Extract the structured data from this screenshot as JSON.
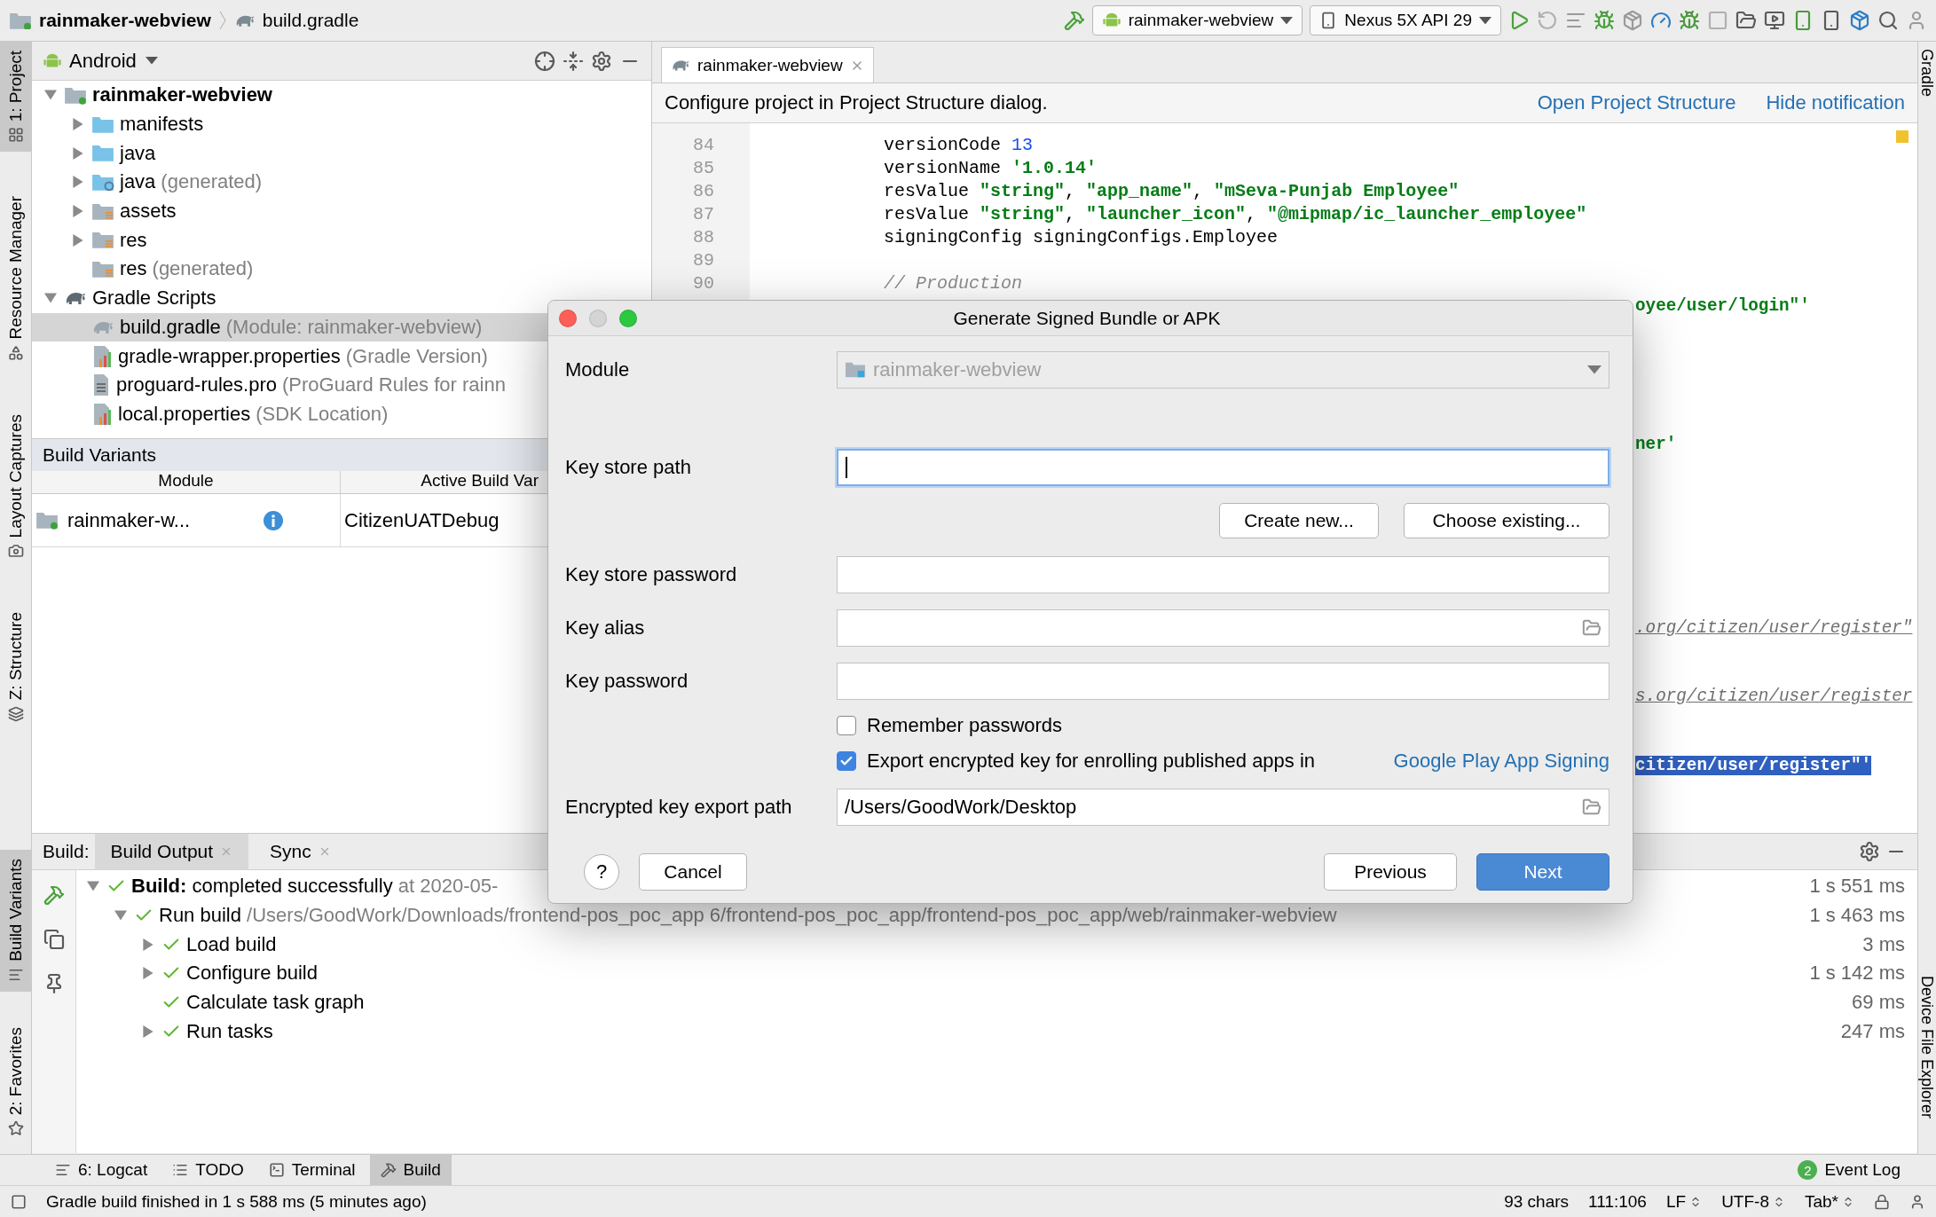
{
  "nav_bar": {
    "breadcrumbs": [
      "rainmaker-webview",
      "build.gradle"
    ],
    "run_config": "rainmaker-webview",
    "device": "Nexus 5X API 29"
  },
  "left_stripe": {
    "top": [
      {
        "label": "1: Project",
        "selected": true
      },
      {
        "label": "Resource Manager",
        "selected": false
      },
      {
        "label": "Layout Captures",
        "selected": false
      },
      {
        "label": "Z: Structure",
        "selected": false
      }
    ],
    "bottom": [
      {
        "label": "Build Variants",
        "selected": true
      },
      {
        "label": "2: Favorites",
        "selected": false
      }
    ]
  },
  "right_stripe": [
    "Gradle",
    "Device File Explorer"
  ],
  "project": {
    "view": "Android",
    "tree": [
      {
        "label": "rainmaker-webview",
        "kind": "module",
        "expanded": true,
        "selected": false,
        "children": [
          {
            "label": "manifests",
            "kind": "folder",
            "expanded": false,
            "selected": false
          },
          {
            "label": "java",
            "kind": "folder",
            "expanded": false,
            "selected": false
          },
          {
            "label": "java",
            "note": "(generated)",
            "kind": "folder-generated",
            "expanded": false,
            "selected": false
          },
          {
            "label": "assets",
            "kind": "folder-resource",
            "expanded": false,
            "selected": false
          },
          {
            "label": "res",
            "kind": "folder-resource",
            "expanded": false,
            "selected": false
          },
          {
            "label": "res",
            "note": "(generated)",
            "kind": "folder-resource",
            "selected": false
          }
        ]
      },
      {
        "label": "Gradle Scripts",
        "kind": "gradle",
        "expanded": true,
        "selected": false,
        "children": [
          {
            "label": "build.gradle",
            "note": "(Module: rainmaker-webview)",
            "kind": "gradle-file",
            "selected": true
          },
          {
            "label": "gradle-wrapper.properties",
            "note": "(Gradle Version)",
            "kind": "properties",
            "selected": false
          },
          {
            "label": "proguard-rules.pro",
            "note": "(ProGuard Rules for rainn",
            "kind": "text-file",
            "selected": false
          },
          {
            "label": "local.properties",
            "note": "(SDK Location)",
            "kind": "properties",
            "selected": false
          }
        ]
      }
    ]
  },
  "build_variants": {
    "title": "Build Variants",
    "columns": [
      "Module",
      "Active Build Var"
    ],
    "rows": [
      {
        "module": "rainmaker-w...",
        "variant": "CitizenUATDebug"
      }
    ]
  },
  "editor": {
    "tab": "rainmaker-webview",
    "notification": {
      "text": "Configure project in Project Structure dialog.",
      "links": [
        "Open Project Structure",
        "Hide notification"
      ]
    },
    "lines": [
      {
        "number": "84",
        "tokens": [
          {
            "text": "versionCode ",
            "kind": "plain"
          },
          {
            "text": "13",
            "kind": "number"
          }
        ]
      },
      {
        "number": "85",
        "tokens": [
          {
            "text": "versionName ",
            "kind": "plain"
          },
          {
            "text": "'1.0.14'",
            "kind": "string"
          }
        ]
      },
      {
        "number": "86",
        "tokens": [
          {
            "text": "resValue ",
            "kind": "plain"
          },
          {
            "text": "\"string\"",
            "kind": "string"
          },
          {
            "text": ", ",
            "kind": "plain"
          },
          {
            "text": "\"app_name\"",
            "kind": "string"
          },
          {
            "text": ", ",
            "kind": "plain"
          },
          {
            "text": "\"mSeva-Punjab Employee\"",
            "kind": "string"
          }
        ]
      },
      {
        "number": "87",
        "tokens": [
          {
            "text": "resValue ",
            "kind": "plain"
          },
          {
            "text": "\"string\"",
            "kind": "string"
          },
          {
            "text": ", ",
            "kind": "plain"
          },
          {
            "text": "\"launcher_icon\"",
            "kind": "string"
          },
          {
            "text": ", ",
            "kind": "plain"
          },
          {
            "text": "\"@mipmap/ic_launcher_employee\"",
            "kind": "string"
          }
        ]
      },
      {
        "number": "88",
        "tokens": [
          {
            "text": "signingConfig signingConfigs.Employee",
            "kind": "plain"
          }
        ]
      },
      {
        "number": "89"
      },
      {
        "number": "90",
        "tokens": [
          {
            "text": "// Production",
            "kind": "comment"
          }
        ]
      }
    ],
    "tail_lines": [
      {
        "text": "oyee/user/login\"'",
        "kind": "string",
        "selected": false
      },
      {
        "text": "ner'",
        "kind": "string",
        "selected": false
      },
      {
        "text": ".org/citizen/user/register\"",
        "kind": "url",
        "selected": false
      },
      {
        "text": "s.org/citizen/user/register",
        "kind": "url",
        "selected": false
      },
      {
        "text": "citizen/user/register\"'",
        "kind": "string",
        "selected": true
      }
    ]
  },
  "build": {
    "label": "Build:",
    "tabs": [
      {
        "label": "Build Output",
        "selected": true
      },
      {
        "label": "Sync",
        "selected": false
      }
    ],
    "tree": [
      {
        "text": "**Build:** completed successfully",
        "note": "at 2020-05-",
        "time": "1 s 551 ms",
        "expanded": true,
        "children": [
          {
            "text": "Run build",
            "note": "/Users/GoodWork/Downloads/frontend-pos_poc_app 6/frontend-pos_poc_app/frontend-pos_poc_app/web/rainmaker-webview",
            "time": "1 s 463 ms",
            "expanded": true,
            "children": [
              {
                "text": "Load build",
                "time": "3 ms",
                "expanded": false
              },
              {
                "text": "Configure build",
                "time": "1 s 142 ms",
                "expanded": false
              },
              {
                "text": "Calculate task graph",
                "time": "69 ms"
              },
              {
                "text": "Run tasks",
                "time": "247 ms",
                "expanded": false
              }
            ]
          }
        ]
      }
    ]
  },
  "tool_tabs": [
    {
      "label": "6: Logcat",
      "selected": false
    },
    {
      "label": "TODO",
      "selected": false
    },
    {
      "label": "Terminal",
      "selected": false
    },
    {
      "label": "Build",
      "selected": true
    }
  ],
  "event_log": {
    "count": "2",
    "label": "Event Log"
  },
  "status_bar": {
    "message": "Gradle build finished in 1 s 588 ms (5 minutes ago)",
    "chars": "93 chars",
    "position": "111:106",
    "line_ending": "LF",
    "encoding": "UTF-8",
    "indent": "Tab*"
  },
  "dialog": {
    "title": "Generate Signed Bundle or APK",
    "module": {
      "label": "Module",
      "value": "rainmaker-webview",
      "disabled": true
    },
    "fields": [
      {
        "label": "Key store path",
        "focused": true,
        "browse": false
      },
      {
        "label": "Key store password",
        "focused": false,
        "browse": false
      },
      {
        "label": "Key alias",
        "focused": false,
        "browse": true
      },
      {
        "label": "Key password",
        "focused": false,
        "browse": false
      }
    ],
    "keystore_buttons": [
      "Create new...",
      "Choose existing..."
    ],
    "checkboxes": [
      {
        "label": "Remember passwords",
        "checked": false
      },
      {
        "label": "Export encrypted key for enrolling published apps in",
        "link": "Google Play App Signing",
        "checked": true
      }
    ],
    "export_path": {
      "label": "Encrypted key export path",
      "value": "/Users/GoodWork/Desktop"
    },
    "help": "?",
    "buttons": [
      {
        "label": "Cancel",
        "kind": "default"
      },
      {
        "label": "Previous",
        "kind": "default"
      },
      {
        "label": "Next",
        "kind": "primary"
      }
    ]
  }
}
